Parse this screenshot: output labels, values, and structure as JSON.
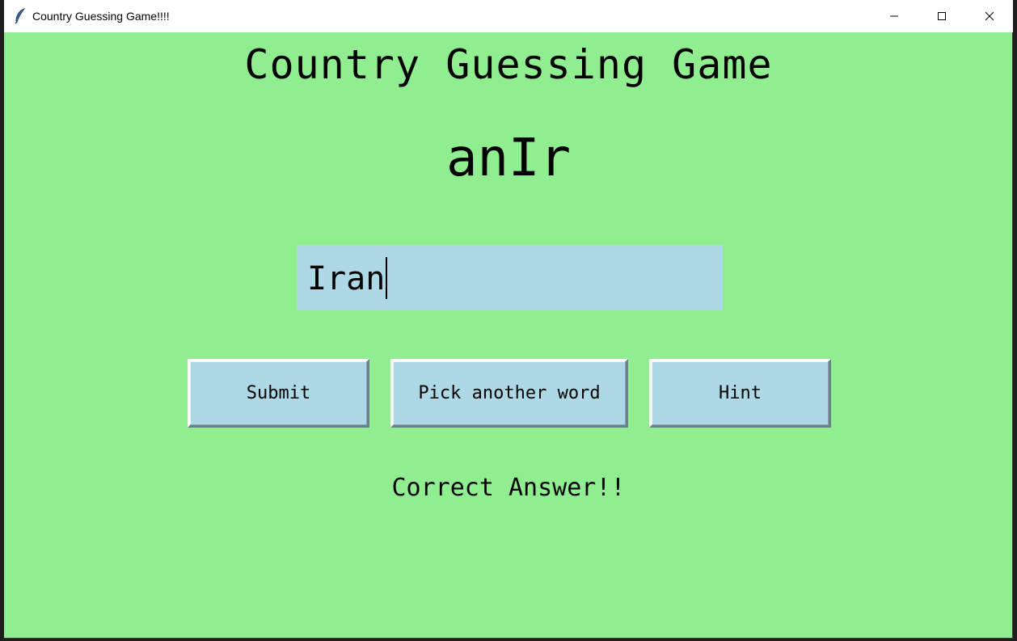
{
  "window": {
    "title": "Country Guessing Game!!!!",
    "app_icon": "feather-icon",
    "controls": {
      "minimize_icon": "minimize-icon",
      "maximize_icon": "maximize-icon",
      "close_icon": "close-icon"
    }
  },
  "game": {
    "heading": "Country Guessing Game",
    "scrambled_word": "anIr",
    "guess_input_value": "Iran",
    "buttons": {
      "submit": "Submit",
      "pick_another": "Pick another word",
      "hint": "Hint"
    },
    "result_message": "Correct Answer!!"
  },
  "colors": {
    "background": "#90ee90",
    "entry_background": "#add8e6",
    "button_background": "#add8e6",
    "text": "#000000"
  }
}
